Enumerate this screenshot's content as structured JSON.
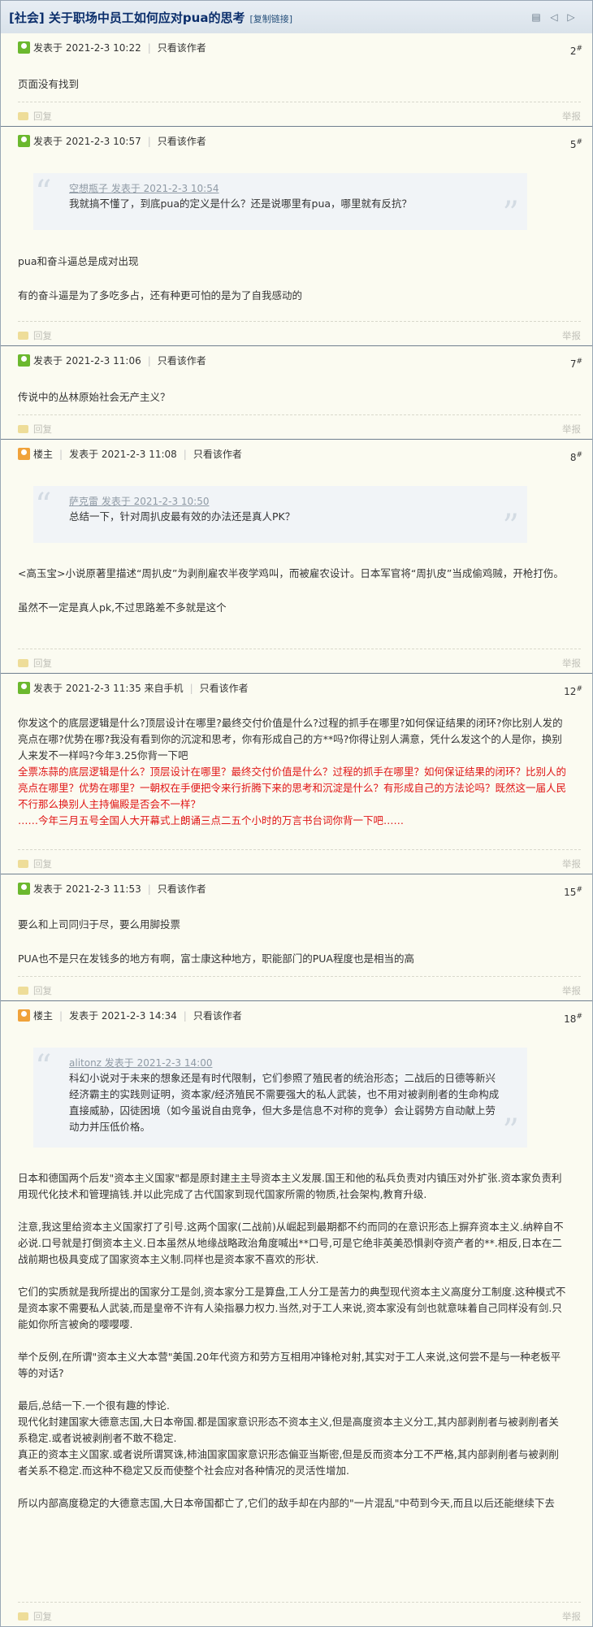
{
  "page": {
    "title": "[社会] 关于职场中员工如何应对pua的思考",
    "copy_link": "[复制链接]",
    "icons": [
      "print-icon",
      "prev-icon",
      "next-icon"
    ]
  },
  "labels": {
    "posted_at": "发表于",
    "only_author": "只看该作者",
    "host": "楼主",
    "reply": "回复",
    "report": "举报",
    "floor_mark": "#",
    "from_mobile": "来自手机"
  },
  "posts": [
    {
      "time": "2021-2-3 10:22",
      "floor": "2",
      "paragraphs": [
        "页面没有找到"
      ]
    },
    {
      "time": "2021-2-3 10:57",
      "floor": "5",
      "quote": {
        "author_time": "空想瓶子 发表于 2021-2-3 10:54",
        "text": "我就搞不懂了，到底pua的定义是什么？还是说哪里有pua，哪里就有反抗？"
      },
      "paragraphs": [
        "pua和奋斗逼总是成对出现",
        "有的奋斗逼是为了多吃多占，还有种更可怕的是为了自我感动的"
      ]
    },
    {
      "time": "2021-2-3 11:06",
      "floor": "7",
      "paragraphs": [
        "传说中的丛林原始社会无产主义？"
      ]
    },
    {
      "time": "2021-2-3 11:08",
      "floor": "8",
      "quote": {
        "author_time": "萨克雷 发表于 2021-2-3 10:50",
        "text": "总结一下，针对周扒皮最有效的办法还是真人PK？"
      },
      "paragraphs": [
        "<高玉宝>小说原著里描述“周扒皮”为剥削雇农半夜学鸡叫，而被雇农设计。日本军官将“周扒皮”当成偷鸡贼，开枪打伤。",
        "虽然不一定是真人pk,不过思路差不多就是这个"
      ]
    },
    {
      "time": "2021-2-3 11:35",
      "floor": "12",
      "body": "你发这个的底层逻辑是什么?顶层设计在哪里?最终交付价值是什么?过程的抓手在哪里?如何保证结果的闭环?你比别人发的亮点在哪?优势在哪?我没有看到你的沉淀和思考，你有形成自己的方**吗?你得让别人满意，凭什么发这个的人是你，换别人来发不一样吗?今年3.25你背一下吧",
      "red_body": "全票冻蒜的底层逻辑是什么？顶层设计在哪里？最终交付价值是什么？过程的抓手在哪里？如何保证结果的闭环？比别人的亮点在哪里？优势在哪里？一朝权在手便把令来行折腾下来的思考和沉淀是什么？有形成自己的方法论吗？既然这一届人民不行那么换别人主持偏殿是否会不一样？",
      "red_tail": "……今年三月五号全国人大开幕式上朗诵三点二五个小时的万言书台词你背一下吧……"
    },
    {
      "time": "2021-2-3 11:53",
      "floor": "15",
      "paragraphs": [
        "要么和上司同归于尽，要么用脚投票",
        "PUA也不是只在发钱多的地方有啊，富士康这种地方，职能部门的PUA程度也是相当的高"
      ]
    },
    {
      "time": "2021-2-3 14:34",
      "floor": "18",
      "quote": {
        "author_time": "alitonz 发表于 2021-2-3 14:00",
        "text": "科幻小说对于未来的想象还是有时代限制，它们参照了殖民者的统治形态；二战后的日德等新兴经济霸主的实践则证明，资本家/经济殖民不需要强大的私人武装，也不用对被剥削者的生命构成直接威胁，囚徒困境（如今虽说自由竞争，但大多是信息不对称的竞争）会让弱势方自动献上劳动力并压低价格。"
      },
      "paragraphs": [
        "日本和德国两个后发\"资本主义国家\"都是原封建主主导资本主义发展.国王和他的私兵负责对内镇压对外扩张.资本家负责利用现代化技术和管理搞钱.并以此完成了古代国家到现代国家所需的物质,社会架构,教育升级.",
        "注意,我这里给资本主义国家打了引号.这两个国家(二战前)从崛起到最期都不约而同的在意识形态上摒弃资本主义.纳粹自不必说.口号就是打倒资本主义.日本虽然从地缘战略政治角度喊出**口号,可是它绝非英美恐惧剥夺资产者的**.相反,日本在二战前期也极具变成了国家资本主义制.同样也是资本家不喜欢的形状.",
        "它们的实质就是我所提出的国家分工是剑,资本家分工是算盘,工人分工是苦力的典型现代资本主义高度分工制度.这种模式不是资本家不需要私人武装,而是皇帝不许有人染指暴力权力.当然,对于工人来说,资本家没有剑也就意味着自己同样没有剑.只能如你所言被肏的嘤嘤嘤.",
        "举个反例,在所谓\"资本主义大本营\"美国.20年代资方和劳方互相用冲锋枪对射,其实对于工人来说,这何尝不是与一种老板平等的对话?",
        "最后,总结一下.一个很有趣的悖论.\n现代化封建国家大德意志国,大日本帝国.都是国家意识形态不资本主义,但是高度资本主义分工,其内部剥削者与被剥削者关系稳定.或者说被剥削者不敢不稳定.\n真正的资本主义国家.或者说所谓冥诛,柿油国家国家意识形态偏亚当斯密,但是反而资本分工不严格,其内部剥削者与被剥削者关系不稳定.而这种不稳定又反而使整个社会应对各种情况的灵活性增加.",
        "所以内部高度稳定的大德意志国,大日本帝国都亡了,它们的敌手却在内部的\"一片混乱\"中苟到今天,而且以后还能继续下去"
      ]
    }
  ]
}
